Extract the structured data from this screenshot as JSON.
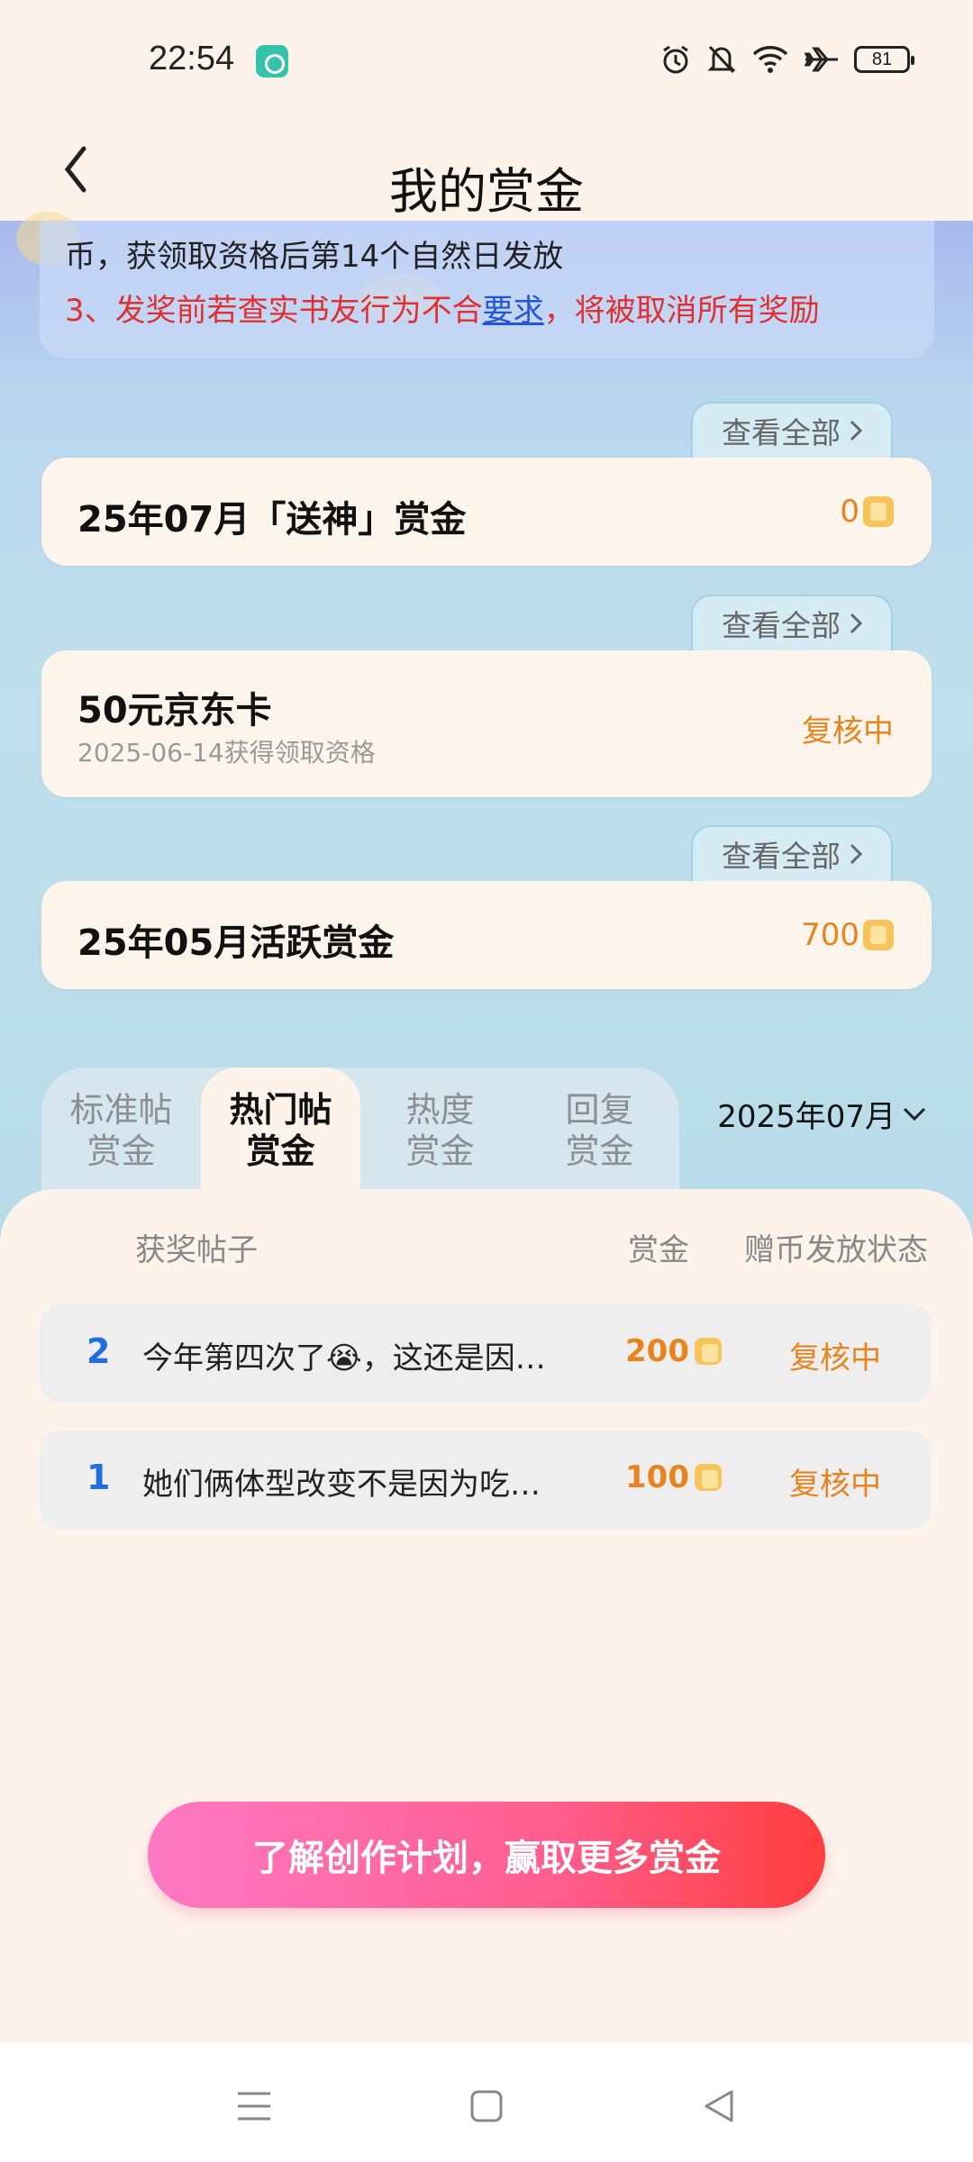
{
  "status_bar": {
    "time": "22:54",
    "battery": "81",
    "icons": [
      "alarm-icon",
      "mute-icon",
      "wifi-icon",
      "airplane-icon",
      "battery-icon"
    ]
  },
  "header": {
    "title": "我的赏金"
  },
  "rules": {
    "line1": "币，获领取资格后第14个自然日发放",
    "line2_prefix": "3、发奖前若查实书友行为不合",
    "line2_link": "要求",
    "line2_suffix": "，将被取消所有奖励"
  },
  "cards": [
    {
      "view_all": "查看全部",
      "title": "25年07月「送神」赏金",
      "value": "0"
    },
    {
      "view_all": "查看全部",
      "title": "50元京东卡",
      "subtitle": "2025-06-14获得领取资格",
      "value": "复核中"
    },
    {
      "view_all": "查看全部",
      "title": "25年05月活跃赏金",
      "value": "700"
    }
  ],
  "tabs": [
    {
      "line1": "标准帖",
      "line2": "赏金"
    },
    {
      "line1": "热门帖",
      "line2": "赏金"
    },
    {
      "line1": "热度",
      "line2": "赏金"
    },
    {
      "line1": "回复",
      "line2": "赏金"
    }
  ],
  "month": "2025年07月",
  "table": {
    "headers": {
      "post": "获奖帖子",
      "reward": "赏金",
      "status": "赠币发放状态"
    },
    "rows": [
      {
        "rank": "2",
        "title": "今年第四次了😭，这还是因…",
        "amount": "200",
        "status": "复核中"
      },
      {
        "rank": "1",
        "title": "她们俩体型改变不是因为吃…",
        "amount": "100",
        "status": "复核中"
      }
    ]
  },
  "cta": "了解创作计划，赢取更多赏金",
  "colors": {
    "accent_orange": "#e8841e",
    "rank_blue": "#1f6fe0",
    "warning_red": "#e03030"
  }
}
